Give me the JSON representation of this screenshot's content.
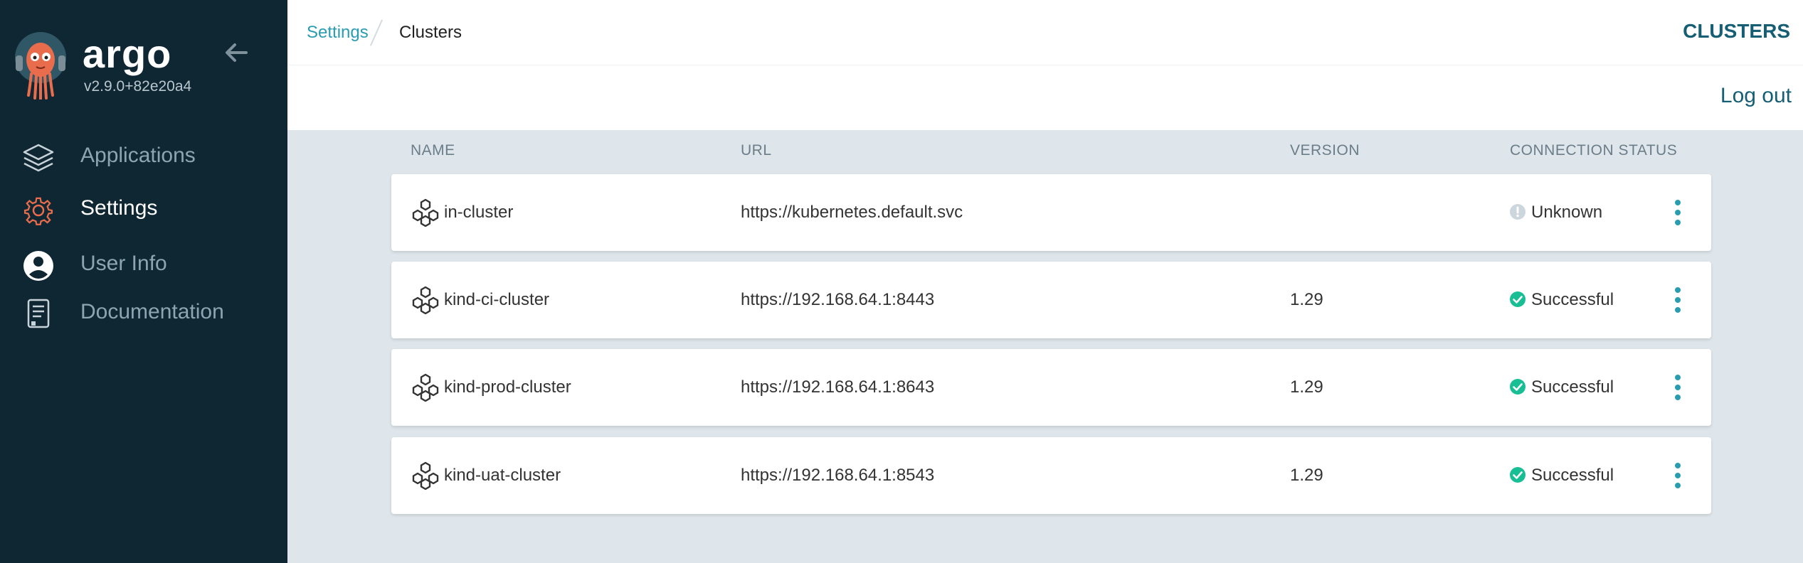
{
  "sidebar": {
    "brand": "argo",
    "version": "v2.9.0+82e20a4",
    "items": [
      {
        "label": "Applications",
        "icon": "layers-icon",
        "active": false
      },
      {
        "label": "Settings",
        "icon": "gear-icon",
        "active": true
      },
      {
        "label": "User Info",
        "icon": "user-icon",
        "active": false
      },
      {
        "label": "Documentation",
        "icon": "docs-icon",
        "active": false
      }
    ]
  },
  "header": {
    "breadcrumb": [
      "Settings",
      "Clusters"
    ],
    "title": "CLUSTERS",
    "logout_label": "Log out"
  },
  "table": {
    "columns": [
      "NAME",
      "URL",
      "VERSION",
      "CONNECTION STATUS"
    ],
    "rows": [
      {
        "name": "in-cluster",
        "url": "https://kubernetes.default.svc",
        "version": "",
        "status": "Unknown"
      },
      {
        "name": "kind-ci-cluster",
        "url": "https://192.168.64.1:8443",
        "version": "1.29",
        "status": "Successful"
      },
      {
        "name": "kind-prod-cluster",
        "url": "https://192.168.64.1:8643",
        "version": "1.29",
        "status": "Successful"
      },
      {
        "name": "kind-uat-cluster",
        "url": "https://192.168.64.1:8543",
        "version": "1.29",
        "status": "Successful"
      }
    ]
  },
  "colors": {
    "sidebar_bg": "#0f2733",
    "accent": "#2a9cb0",
    "title": "#165e74",
    "success": "#18be94",
    "unknown": "#ccd6dd",
    "logo_orange": "#e96d4c"
  }
}
